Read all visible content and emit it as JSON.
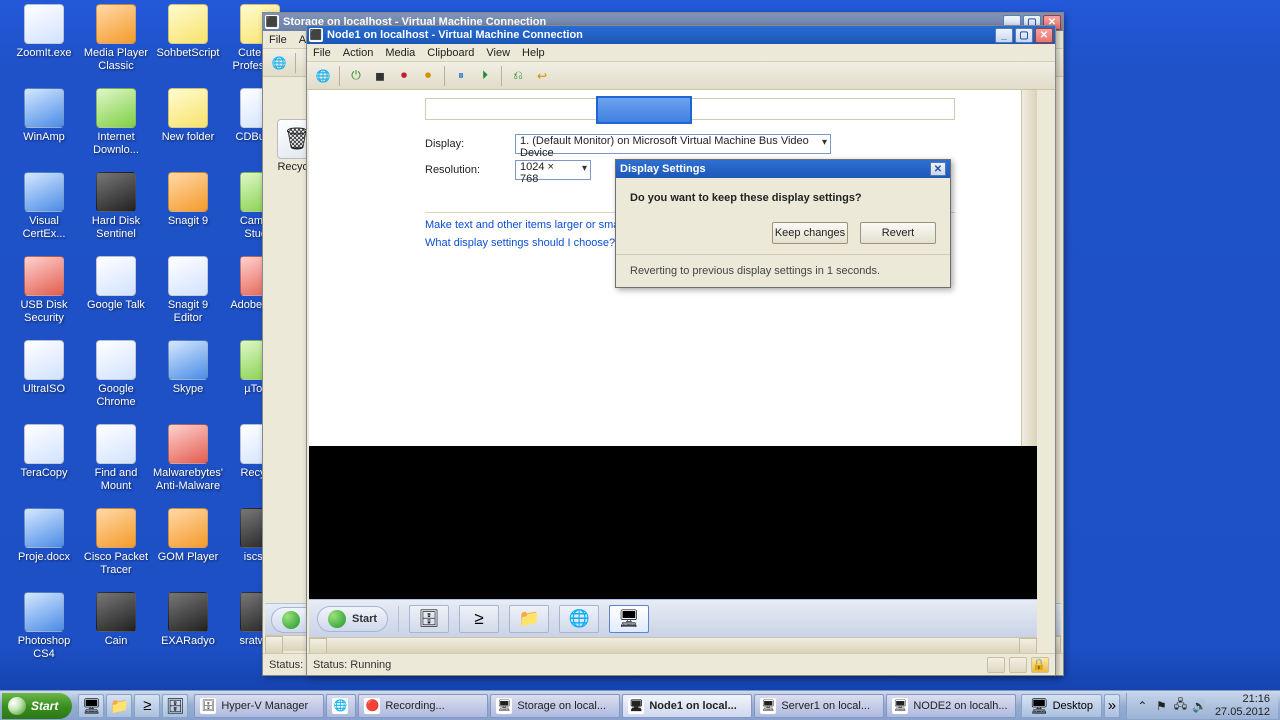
{
  "desktop_icons": [
    {
      "label": "ZoomIt.exe",
      "cls": ""
    },
    {
      "label": "Media Player Classic",
      "cls": "ic-orange"
    },
    {
      "label": "SohbetScript",
      "cls": "ic-yellow"
    },
    {
      "label": "CuteFTP Professio...",
      "cls": "ic-yellow"
    },
    {
      "label": "WinAmp",
      "cls": "ic-blue"
    },
    {
      "label": "Internet Downlo...",
      "cls": "ic-green"
    },
    {
      "label": "New folder",
      "cls": "ic-yellow"
    },
    {
      "label": "CDBurner",
      "cls": ""
    },
    {
      "label": "Visual CertEx...",
      "cls": "ic-blue"
    },
    {
      "label": "Hard Disk Sentinel",
      "cls": "ic-dark"
    },
    {
      "label": "Snagit 9",
      "cls": "ic-orange"
    },
    {
      "label": "Camtasi Studio",
      "cls": "ic-green"
    },
    {
      "label": "USB Disk Security",
      "cls": "ic-red"
    },
    {
      "label": "Google Talk",
      "cls": ""
    },
    {
      "label": "Snagit 9 Editor",
      "cls": ""
    },
    {
      "label": "Adobe Re X",
      "cls": "ic-red"
    },
    {
      "label": "UltraISO",
      "cls": ""
    },
    {
      "label": "Google Chrome",
      "cls": ""
    },
    {
      "label": "Skype",
      "cls": "ic-blue"
    },
    {
      "label": "µTorre",
      "cls": "ic-green"
    },
    {
      "label": "TeraCopy",
      "cls": ""
    },
    {
      "label": "Find and Mount",
      "cls": ""
    },
    {
      "label": "Malwarebytes' Anti-Malware",
      "cls": "ic-red"
    },
    {
      "label": "Recycle",
      "cls": ""
    },
    {
      "label": "Proje.docx",
      "cls": "ic-blue"
    },
    {
      "label": "Cisco Packet Tracer",
      "cls": "ic-orange"
    },
    {
      "label": "GOM Player",
      "cls": "ic-orange"
    },
    {
      "label": "iscsi.is",
      "cls": "ic-dark"
    },
    {
      "label": "Photoshop CS4",
      "cls": "ic-blue"
    },
    {
      "label": "Cain",
      "cls": "ic-dark"
    },
    {
      "label": "EXARadyo",
      "cls": "ic-dark"
    },
    {
      "label": "sratwind",
      "cls": "ic-dark"
    }
  ],
  "bg_window": {
    "title": "Storage on localhost - Virtual Machine Connection",
    "menu": [
      "File",
      "Ac"
    ],
    "status": "Status: R",
    "recycle": "Recycle"
  },
  "vm": {
    "title": "Node1 on localhost - Virtual Machine Connection",
    "menu": [
      "File",
      "Action",
      "Media",
      "Clipboard",
      "View",
      "Help"
    ],
    "cp": {
      "display_label": "Display:",
      "display_value": "1. (Default Monitor) on Microsoft Virtual Machine Bus Video Device",
      "resolution_label": "Resolution:",
      "resolution_value": "1024 × 768",
      "link1": "Make text and other items larger or smaller",
      "link2": "What display settings should I choose?"
    },
    "dialog": {
      "title": "Display Settings",
      "question": "Do you want to keep these display settings?",
      "keep": "Keep changes",
      "revert": "Revert",
      "countdown": "Reverting to previous display settings in 1 seconds."
    },
    "taskbar": {
      "start": "Start"
    },
    "scroll_right_label": "",
    "status": "Status: Running"
  },
  "host_taskbar": {
    "start": "Start",
    "tasks": [
      {
        "label": "Hyper-V Manager",
        "active": false
      },
      {
        "label": "",
        "active": false,
        "icon_only": true
      },
      {
        "label": "Recording...",
        "active": false
      },
      {
        "label": "Storage on local...",
        "active": false
      },
      {
        "label": "Node1 on local...",
        "active": true
      },
      {
        "label": "Server1 on local...",
        "active": false
      },
      {
        "label": "NODE2 on localh...",
        "active": false
      }
    ],
    "desktop_btn": "Desktop",
    "time": "21:16",
    "date": "27.05.2012"
  }
}
